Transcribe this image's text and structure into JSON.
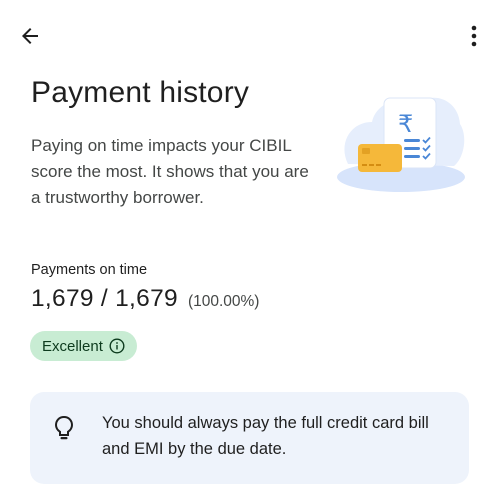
{
  "header": {
    "back_icon": "arrow-back-icon",
    "more_icon": "more-vert-icon"
  },
  "page": {
    "title": "Payment history",
    "description": "Paying on time impacts your CIBIL score the most. It shows that you are a trustworthy borrower."
  },
  "illustration": {
    "icon": "credit-card-receipt-illustration",
    "rupee_symbol": "₹",
    "colors": {
      "cloud": "#e3ecfb",
      "card": "#f5b83a",
      "accent": "#4a87d6"
    }
  },
  "payments": {
    "label": "Payments on time",
    "count": "1,679 / 1,679",
    "percentage": "(100.00%)"
  },
  "status": {
    "label": "Excellent",
    "icon": "info-icon",
    "color": "#c8ecd3"
  },
  "tip": {
    "icon": "lightbulb-icon",
    "text": "You should always pay the full credit card bill and EMI by the due date."
  }
}
